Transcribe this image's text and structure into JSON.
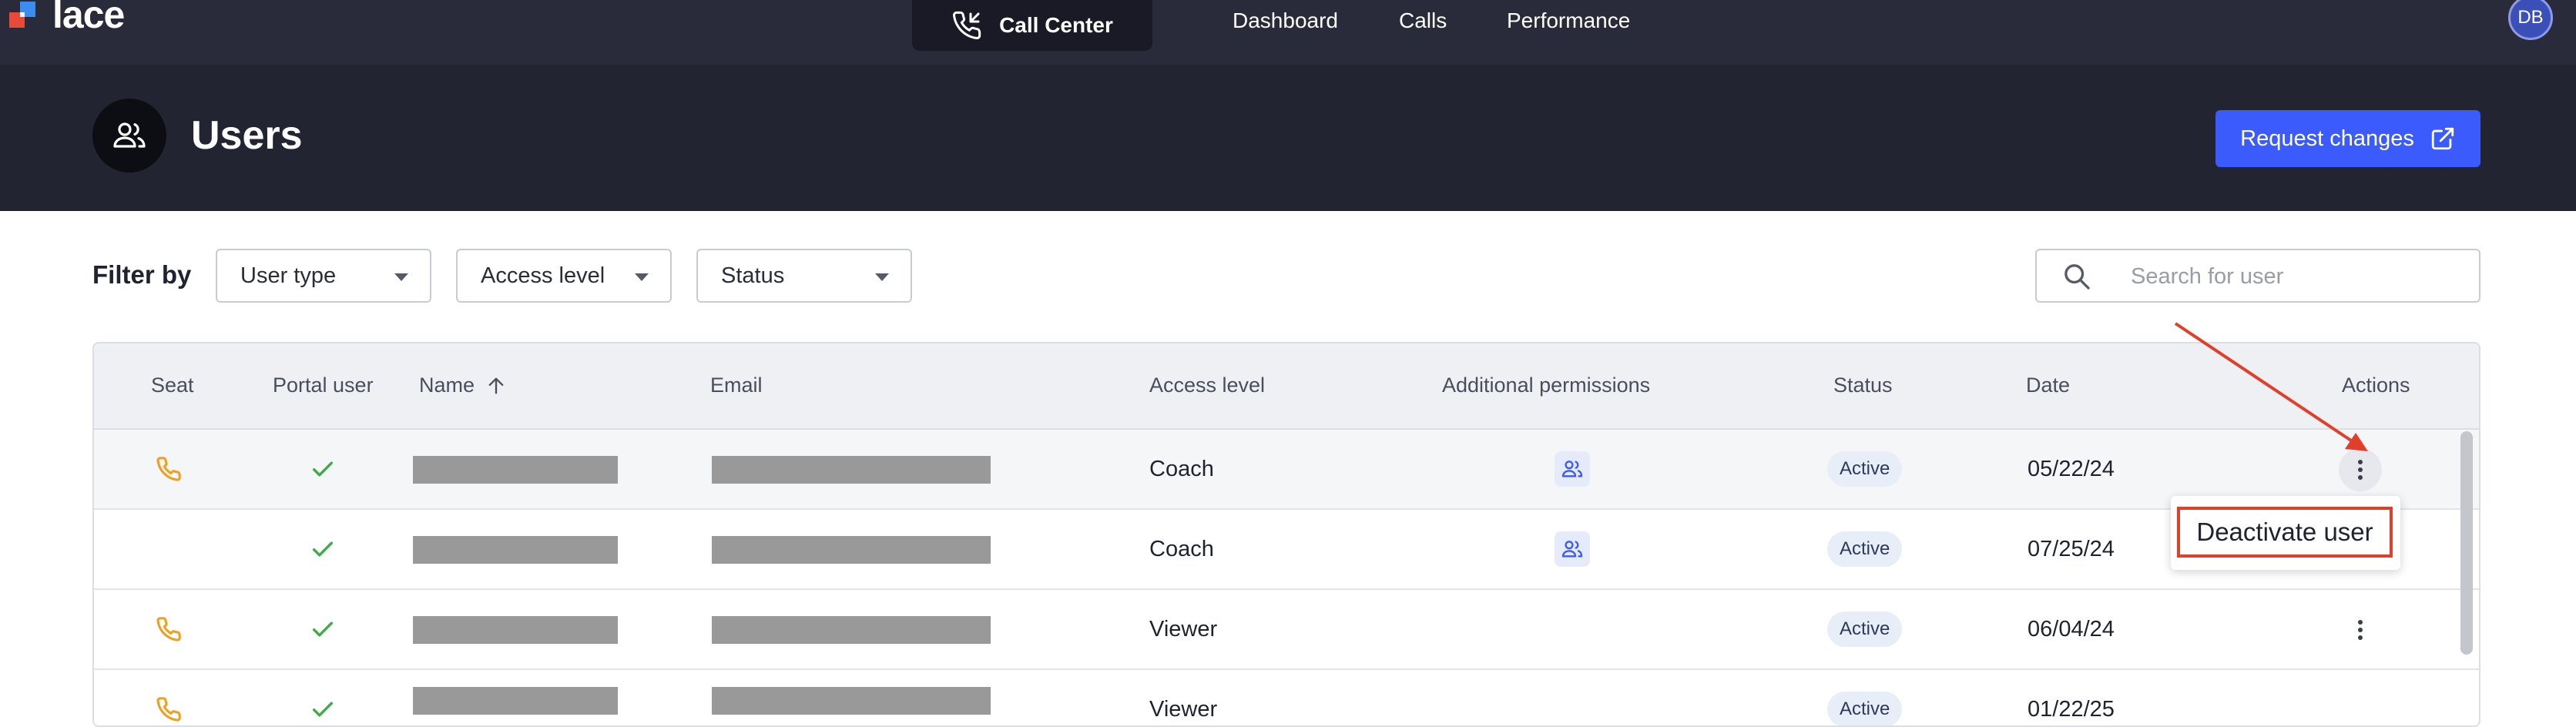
{
  "app": {
    "logo_text": "lace",
    "active_section": "Call Center",
    "nav_links": [
      "Dashboard",
      "Calls",
      "Performance"
    ],
    "user_initials": "DB"
  },
  "header": {
    "title": "Users",
    "request_button": "Request changes"
  },
  "filters": {
    "label": "Filter by",
    "user_type": "User type",
    "access_level": "Access level",
    "status": "Status",
    "search_placeholder": "Search for user"
  },
  "table": {
    "columns": [
      "Seat",
      "Portal user",
      "Name",
      "Email",
      "Access level",
      "Additional permissions",
      "Status",
      "Date",
      "Actions"
    ],
    "sort_column": "Name",
    "sort_direction": "ascending",
    "rows": [
      {
        "seat": true,
        "portal_user": true,
        "name": "[redacted]",
        "email": "[redacted]",
        "access_level": "Coach",
        "additional_permissions": "team-icon",
        "status": "Active",
        "date": "05/22/24",
        "highlighted": true
      },
      {
        "seat": false,
        "portal_user": true,
        "name": "[redacted]",
        "email": "[redacted]",
        "access_level": "Coach",
        "additional_permissions": "team-icon",
        "status": "Active",
        "date": "07/25/24",
        "highlighted": false
      },
      {
        "seat": true,
        "portal_user": true,
        "name": "[redacted]",
        "email": "[redacted]",
        "access_level": "Viewer",
        "additional_permissions": "",
        "status": "Active",
        "date": "06/04/24",
        "highlighted": false
      },
      {
        "seat": true,
        "portal_user": true,
        "name": "[redacted]",
        "email": "[redacted]",
        "access_level": "Viewer",
        "additional_permissions": "",
        "status": "Active",
        "date": "01/22/25",
        "highlighted": false
      }
    ]
  },
  "action_menu": {
    "items": [
      "Deactivate user"
    ]
  },
  "colors": {
    "nav_bg": "#2a2b3a",
    "header_bg": "#222432",
    "accent": "#3b5bfd",
    "seat_icon": "#f0a020",
    "check_icon": "#3faa4a",
    "annotation": "#e0402a"
  }
}
